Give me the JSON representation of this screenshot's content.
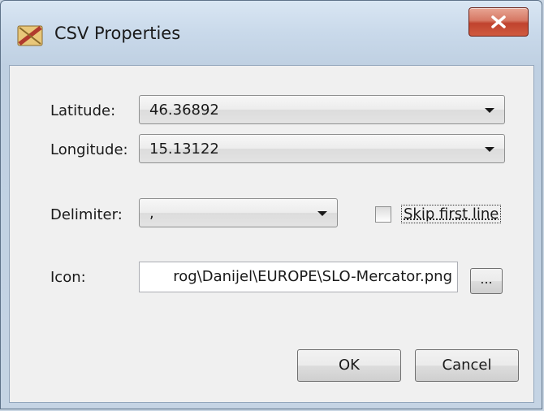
{
  "window": {
    "title": "CSV Properties",
    "icons": {
      "app": "csv-map-icon",
      "close": "close-icon"
    },
    "colors": {
      "close_button": "#c7503a",
      "frame": "#c5d4e4",
      "client": "#f0f0f0"
    }
  },
  "form": {
    "latitude": {
      "label": "Latitude:",
      "value": "46.36892"
    },
    "longitude": {
      "label": "Longitude:",
      "value": "15.13122"
    },
    "delimiter": {
      "label": "Delimiter:",
      "value": ","
    },
    "skip_first_line": {
      "label": "Skip first line",
      "checked": false
    },
    "icon": {
      "label": "Icon:",
      "value": "rog\\Danijel\\EUROPE\\SLO-Mercator.png",
      "browse_label": "..."
    }
  },
  "buttons": {
    "ok_label": "OK",
    "cancel_label": "Cancel"
  }
}
